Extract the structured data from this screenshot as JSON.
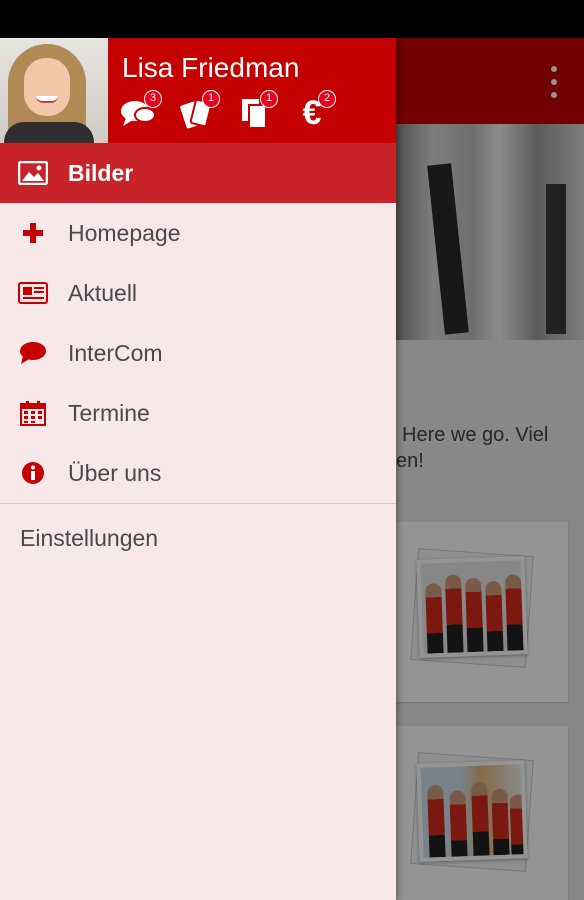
{
  "colors": {
    "brand_red": "#c40000",
    "active_item": "#c8232a",
    "drawer_bg": "#f8e8e9",
    "badge": "#e8001c"
  },
  "drawer": {
    "user_name": "Lisa Friedman",
    "header_icons": [
      {
        "icon": "chat-bubbles-icon",
        "badge": "3"
      },
      {
        "icon": "tickets-icon",
        "badge": "1"
      },
      {
        "icon": "documents-icon",
        "badge": "1"
      },
      {
        "icon": "euro-icon",
        "badge": "2"
      }
    ],
    "menu": [
      {
        "icon": "image-icon",
        "label": "Bilder",
        "active": true
      },
      {
        "icon": "plus-icon",
        "label": "Homepage",
        "active": false
      },
      {
        "icon": "newspaper-icon",
        "label": "Aktuell",
        "active": false
      },
      {
        "icon": "chat-icon",
        "label": "InterCom",
        "active": false
      },
      {
        "icon": "calendar-icon",
        "label": "Termine",
        "active": false
      },
      {
        "icon": "info-icon",
        "label": "Über uns",
        "active": false
      }
    ],
    "settings_label": "Einstellungen"
  },
  "background": {
    "welcome_line1": "Here we go. Viel",
    "welcome_line2": "en!"
  }
}
